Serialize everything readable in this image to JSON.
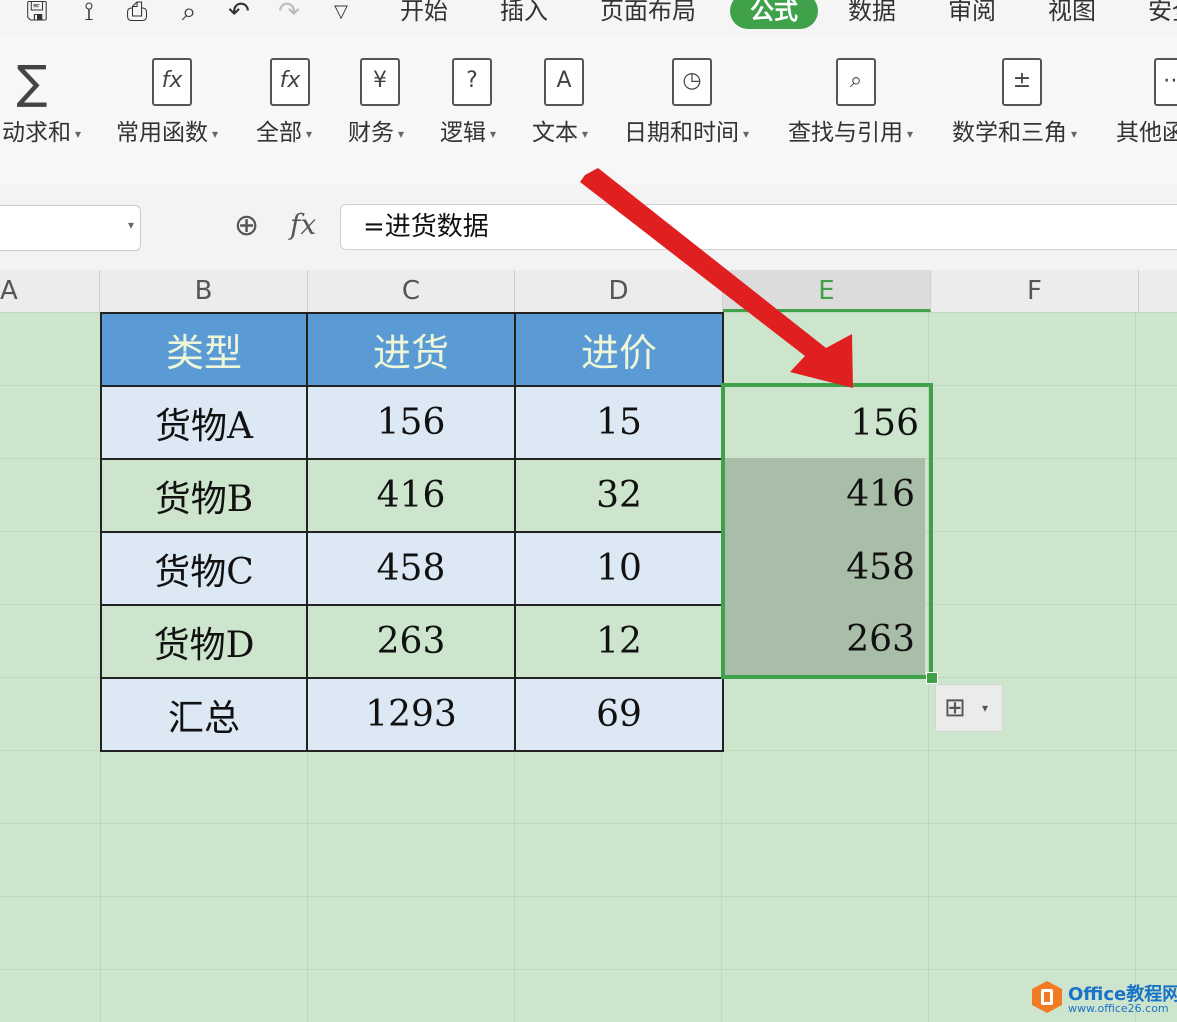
{
  "quick_access": {
    "icons": [
      "save-icon",
      "format-painter-icon",
      "print-icon",
      "print-preview-icon",
      "undo-icon",
      "redo-icon",
      "customize-icon"
    ]
  },
  "menu": {
    "items": [
      "开始",
      "插入",
      "页面布局",
      "公式",
      "数据",
      "审阅",
      "视图",
      "安全"
    ],
    "active": "公式"
  },
  "ribbon": {
    "buttons": [
      {
        "label": "动求和",
        "icon": "sum-icon",
        "glyph": "∑"
      },
      {
        "label": "常用函数",
        "icon": "common-function-icon",
        "glyph": "fx"
      },
      {
        "label": "全部",
        "icon": "all-functions-icon",
        "glyph": "fx"
      },
      {
        "label": "财务",
        "icon": "finance-icon",
        "glyph": "¥"
      },
      {
        "label": "逻辑",
        "icon": "logic-icon",
        "glyph": "?"
      },
      {
        "label": "文本",
        "icon": "text-icon",
        "glyph": "A"
      },
      {
        "label": "日期和时间",
        "icon": "datetime-icon",
        "glyph": "◷"
      },
      {
        "label": "查找与引用",
        "icon": "lookup-icon",
        "glyph": "⌕"
      },
      {
        "label": "数学和三角",
        "icon": "math-icon",
        "glyph": "±"
      },
      {
        "label": "其他函",
        "icon": "other-functions-icon",
        "glyph": "⋯"
      }
    ]
  },
  "formula_bar": {
    "fx_label": "fx",
    "formula": "=进货数据"
  },
  "columns": [
    "A",
    "B",
    "C",
    "D",
    "E",
    "F"
  ],
  "selected_column": "E",
  "table": {
    "headers": [
      "类型",
      "进货",
      "进价"
    ],
    "rows": [
      [
        "货物A",
        "156",
        "15"
      ],
      [
        "货物B",
        "416",
        "32"
      ],
      [
        "货物C",
        "458",
        "10"
      ],
      [
        "货物D",
        "263",
        "12"
      ]
    ],
    "total": [
      "汇总",
      "1293",
      "69"
    ]
  },
  "column_e_values": [
    "156",
    "416",
    "458",
    "263"
  ],
  "colors": {
    "accent": "#3fa14a",
    "header_fill": "#5b9bd5",
    "sheet_bg": "#cde5cc",
    "arrow": "#e02020"
  },
  "watermark": {
    "title": "Office教程网",
    "url": "www.office26.com"
  }
}
